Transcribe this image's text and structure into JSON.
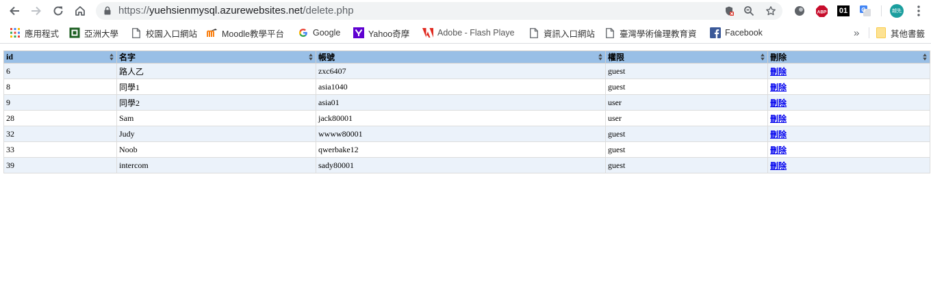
{
  "browser": {
    "url_host": "yuehsienmysql.azurewebsites.net",
    "url_path": "/delete.php",
    "url_scheme": "https://",
    "profile_label": "越先"
  },
  "bookmarks": [
    {
      "label": "應用程式",
      "icon": "apps-grid-icon"
    },
    {
      "label": "亞洲大學",
      "icon": "asia-university-icon"
    },
    {
      "label": "校園入口網站",
      "icon": "page-icon"
    },
    {
      "label": "Moodle教學平台",
      "icon": "moodle-icon"
    },
    {
      "label": "Google",
      "icon": "google-icon"
    },
    {
      "label": "Yahoo奇摩",
      "icon": "yahoo-icon"
    },
    {
      "label": "Adobe - Flash Playe",
      "icon": "adobe-icon"
    },
    {
      "label": "資訊入口網站",
      "icon": "page-icon"
    },
    {
      "label": "臺灣學術倫理教育資",
      "icon": "page-icon"
    },
    {
      "label": "Facebook",
      "icon": "facebook-icon"
    }
  ],
  "other_bookmarks": "其他書籤",
  "extensions": {
    "abp_label": "ABP",
    "o1_label": "01"
  },
  "table": {
    "headers": [
      "id",
      "名字",
      "帳號",
      "權限",
      "刪除"
    ],
    "rows": [
      {
        "id": "6",
        "name": "路人乙",
        "account": "zxc6407",
        "role": "guest",
        "action": "刪除"
      },
      {
        "id": "8",
        "name": "同學1",
        "account": "asia1040",
        "role": "guest",
        "action": "刪除"
      },
      {
        "id": "9",
        "name": "同學2",
        "account": "asia01",
        "role": "user",
        "action": "刪除"
      },
      {
        "id": "28",
        "name": "Sam",
        "account": "jack80001",
        "role": "user",
        "action": "刪除"
      },
      {
        "id": "32",
        "name": "Judy",
        "account": "wwww80001",
        "role": "guest",
        "action": "刪除"
      },
      {
        "id": "33",
        "name": "Noob",
        "account": "qwerbake12",
        "role": "guest",
        "action": "刪除"
      },
      {
        "id": "39",
        "name": "intercom",
        "account": "sady80001",
        "role": "guest",
        "action": "刪除"
      }
    ]
  },
  "colors": {
    "header_bg": "#99bfe6",
    "odd_row_bg": "#ebf2fa",
    "link": "#0000ee"
  }
}
